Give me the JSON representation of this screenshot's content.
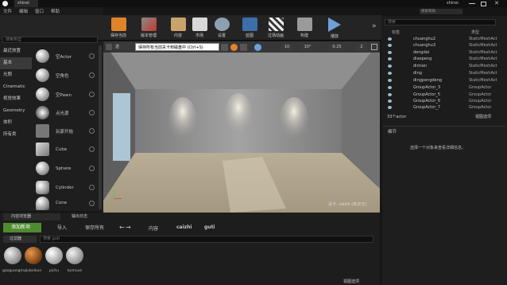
{
  "titlebar": {
    "tab": "shinei",
    "search_placeholder": "搜索帮助",
    "user": "shinei"
  },
  "menubar": [
    "文件",
    "编辑",
    "窗口",
    "帮助"
  ],
  "toolbar": {
    "buttons": [
      "保存当前",
      "版本管理",
      "内容",
      "市场",
      "设置",
      "蓝图",
      "过场动画",
      "构建",
      "播放"
    ]
  },
  "modes": {
    "search_placeholder": "搜索类型",
    "categories": [
      "最近放置",
      "基本",
      "光照",
      "Cinematic",
      "视觉效果",
      "Geometry",
      "体积",
      "所有类"
    ],
    "selected": "基本",
    "items": [
      "空Actor",
      "空角色",
      "空Pawn",
      "点光源",
      "玩家开始",
      "Cube",
      "Sphere",
      "Cylinder",
      "Cone"
    ]
  },
  "viewport": {
    "tooltip": "保存所有当前关卡到磁盘中 (Ctrl+S)",
    "snap_values": [
      "10",
      "10°",
      "0.25",
      "2"
    ],
    "perspective_button": "透",
    "level_label": "关卡: caizhi (未次元)"
  },
  "outliner": {
    "search_placeholder": "搜索",
    "columns": [
      "标签",
      "类型"
    ],
    "rows": [
      {
        "name": "chuanghu2",
        "type": "StaticMeshAct"
      },
      {
        "name": "chuanghu3",
        "type": "StaticMeshAct"
      },
      {
        "name": "dengdai",
        "type": "StaticMeshAct"
      },
      {
        "name": "diaopeng",
        "type": "StaticMeshAct"
      },
      {
        "name": "dimian",
        "type": "StaticMeshAct"
      },
      {
        "name": "ding",
        "type": "StaticMeshAct"
      },
      {
        "name": "dingpengdeng",
        "type": "StaticMeshAct"
      },
      {
        "name": "GroupActor_3",
        "type": "GroupActor"
      },
      {
        "name": "GroupActor_5",
        "type": "GroupActor"
      },
      {
        "name": "GroupActor_6",
        "type": "GroupActor"
      },
      {
        "name": "GroupActor_7",
        "type": "GroupActor"
      }
    ],
    "count": "33个actor",
    "view_options": "视图选项"
  },
  "details": {
    "tab": "细节",
    "empty_text": "选择一个对象来查看详细信息。"
  },
  "content_browser": {
    "tabs": [
      "内容浏览器",
      "输出日志"
    ],
    "add_new": "添加新项",
    "import": "导入",
    "save_all": "保存所有",
    "path": [
      "内容",
      "caizhi",
      "guti"
    ],
    "filters": "过滤器",
    "search_placeholder": "搜索 guti",
    "assets": [
      {
        "label": "gaoguangmu",
        "color": "#c9c9c9"
      },
      {
        "label": "jiubeikun",
        "color": "#b5702a"
      },
      {
        "label": "pichu",
        "color": "#d8d8d8"
      },
      {
        "label": "tuimuun",
        "color": "#cfcfcf"
      }
    ],
    "view_options": "视图选项"
  },
  "colors": {
    "accent": "#e0842a",
    "add_button": "#4f8b2f"
  }
}
